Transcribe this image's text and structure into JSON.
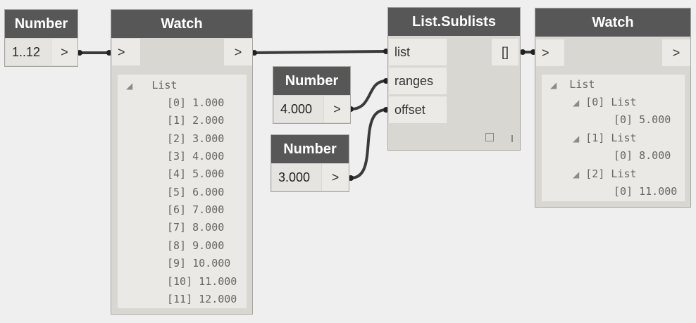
{
  "nodes": {
    "number_range": {
      "title": "Number",
      "value": "1..12",
      "out_port": ">"
    },
    "watch_left": {
      "title": "Watch",
      "in_port": ">",
      "out_port": ">"
    },
    "number_ranges": {
      "title": "Number",
      "value": "4.000",
      "out_port": ">"
    },
    "number_offset": {
      "title": "Number",
      "value": "3.000",
      "out_port": ">"
    },
    "sublists": {
      "title": "List.Sublists",
      "inputs": [
        "list",
        "ranges",
        "offset"
      ],
      "output": "[]"
    },
    "watch_right": {
      "title": "Watch",
      "in_port": ">",
      "out_port": ">"
    }
  },
  "watch_left_tree": {
    "root": "List",
    "items": [
      "[0] 1.000",
      "[1] 2.000",
      "[2] 3.000",
      "[3] 4.000",
      "[4] 5.000",
      "[5] 6.000",
      "[6] 7.000",
      "[7] 8.000",
      "[8] 9.000",
      "[9] 10.000",
      "[10] 11.000",
      "[11] 12.000"
    ]
  },
  "watch_right_tree": {
    "root": "List",
    "sub": [
      {
        "label": "[0] List",
        "item": "[0] 5.000"
      },
      {
        "label": "[1] List",
        "item": "[0] 8.000"
      },
      {
        "label": "[2] List",
        "item": "[0] 11.000"
      }
    ]
  },
  "colors": {
    "header": "#575757",
    "wire": "#3a3a3a",
    "node_body": "#d9d7d2",
    "canvas": "#efefef"
  },
  "icons": {
    "collapse": "collapse-triangle-icon",
    "preview_toggle": "preview-square-icon",
    "lacing": "lacing-bar-icon"
  }
}
